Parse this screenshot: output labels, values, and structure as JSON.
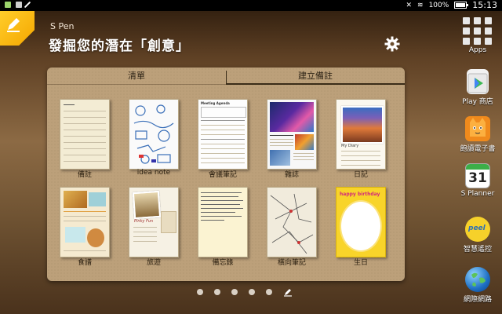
{
  "status_bar": {
    "time": "15:13",
    "battery": "100%"
  },
  "header": {
    "label": "S Pen",
    "title": "發掘您的潛在「創意」"
  },
  "tabs": [
    {
      "label": "清單",
      "selected": false
    },
    {
      "label": "建立備註",
      "selected": true
    }
  ],
  "templates": [
    {
      "label": "備註"
    },
    {
      "label": "idea note"
    },
    {
      "label": "會議筆記"
    },
    {
      "label": "雜誌"
    },
    {
      "label": "日記"
    },
    {
      "label": "食譜"
    },
    {
      "label": "旅遊"
    },
    {
      "label": "備忘錄"
    },
    {
      "label": "橫向筆記"
    },
    {
      "label": "生日"
    }
  ],
  "template_text": {
    "meeting_heading": "Meeting Agenda",
    "diary_heading": "My Diary",
    "travel_heading": "Pinky Fun",
    "birthday_heading": "happy birthday"
  },
  "page_indicator": {
    "pages": 5
  },
  "sidebar_apps": [
    {
      "label": "Apps",
      "icon": "apps-grid-icon"
    },
    {
      "label": "Play 商店",
      "icon": "play-store-icon"
    },
    {
      "label": "飽讀電子書",
      "icon": "ebook-icon"
    },
    {
      "label": "S Planner",
      "icon": "calendar-icon",
      "day": "31"
    },
    {
      "label": "智慧遙控",
      "icon": "peel-remote-icon"
    },
    {
      "label": "網際網路",
      "icon": "globe-icon"
    }
  ],
  "colors": {
    "accent": "#f5b400",
    "panel": "#bca07a",
    "birthday_cover": "#f8d42a"
  }
}
